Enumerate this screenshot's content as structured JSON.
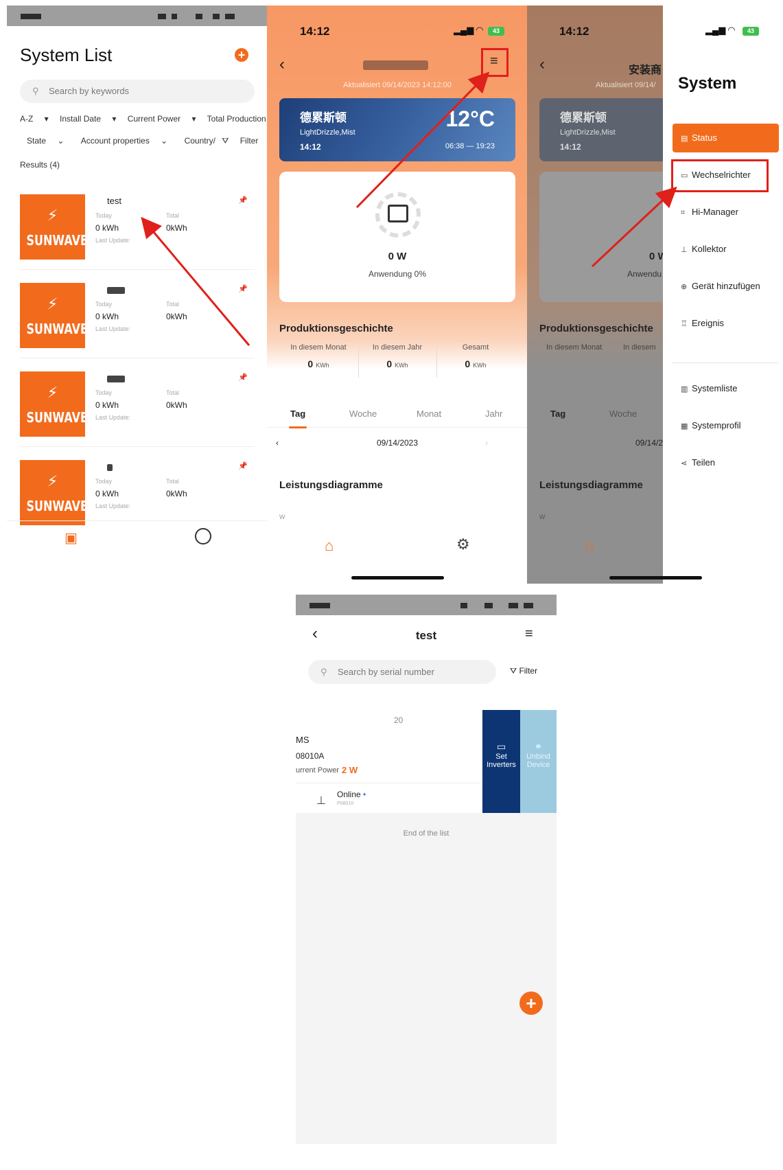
{
  "system_list": {
    "title": "System List",
    "search_placeholder": "Search by keywords",
    "sort_filters": [
      "A-Z",
      "Install Date",
      "Current Power",
      "Total Production"
    ],
    "filters": [
      "State",
      "Account properties",
      "Country/",
      "Filter"
    ],
    "results": "Results (4)",
    "today_label": "Today",
    "total_label": "Total",
    "last_update_label": "Last Update:",
    "logo_text": "SUNWAVE",
    "cards": [
      {
        "name": "test",
        "today": "0 kWh",
        "total": "0kWh"
      },
      {
        "name": "",
        "today": "0 kWh",
        "total": "0kWh"
      },
      {
        "name": "",
        "today": "0 kWh",
        "total": "0kWh"
      },
      {
        "name": "",
        "today": "0 kWh",
        "total": "0kWh"
      }
    ]
  },
  "plant_detail": {
    "time": "14:12",
    "battery": "43",
    "updated": "Aktualisiert 09/14/2023 14:12:00",
    "weather": {
      "city": "德累斯顿",
      "condition": "LightDrizzle,Mist",
      "time": "14:12",
      "temperature": "12°C",
      "sun": "06:38 — 19:23"
    },
    "power": "0 W",
    "usage": "Anwendung 0%",
    "history_title": "Produktionsgeschichte",
    "stats": [
      {
        "label": "In diesem Monat",
        "value": "0",
        "unit": "KWh"
      },
      {
        "label": "In diesem Jahr",
        "value": "0",
        "unit": "KWh"
      },
      {
        "label": "Gesamt",
        "value": "0",
        "unit": "KWh"
      }
    ],
    "tabs": [
      "Tag",
      "Woche",
      "Monat",
      "Jahr"
    ],
    "date": "09/14/2023",
    "chart_title": "Leistungsdiagramme",
    "chart_unit": "W"
  },
  "side_menu": {
    "time": "14:12",
    "header_partial": "安装商",
    "updated_partial": "Aktualisiert 09/14/",
    "bg_city": "德累斯顿",
    "bg_condition": "LightDrizzle,Mist",
    "bg_time": "14:12",
    "bg_power": "0 W",
    "bg_usage": "Anwendu",
    "bg_history_title": "Produktionsgeschichte",
    "bg_stat1": "In diesem Monat",
    "bg_stat2": "In diesem",
    "bg_tab1": "Tag",
    "bg_tab2": "Woche",
    "bg_date": "09/14/2",
    "bg_chart_title": "Leistungsdiagramme",
    "bg_chart_unit": "W",
    "title": "System",
    "items": [
      "Status",
      "Wechselrichter",
      "Hi-Manager",
      "Kollektor",
      "Gerät hinzufügen",
      "Ereignis"
    ],
    "items2": [
      "Systemliste",
      "Systemprofil",
      "Teilen"
    ]
  },
  "device_list": {
    "title": "test",
    "search_placeholder": "Search by serial number",
    "filter": "Filter",
    "device_date": "20",
    "device_model": "MS",
    "device_serial": "08010A",
    "power_label": "urrent Power",
    "power_value": "2 W",
    "status": "Online",
    "status_sub": "P08010",
    "set_inverters": "Set Inverters",
    "unbind_device": "Unbind Device",
    "end_text": "End of the list"
  },
  "colors": {
    "accent": "#f26b1d",
    "highlight": "#e0201a",
    "set_button": "#0d3574",
    "unbind_button": "#9ccbe0"
  }
}
